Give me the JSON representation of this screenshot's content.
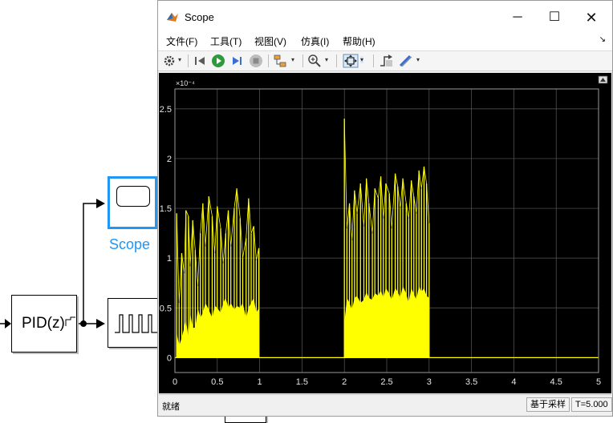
{
  "window": {
    "title": "Scope",
    "controls": {
      "minimize": "─",
      "maximize": "☐",
      "close": "✕"
    }
  },
  "menu": {
    "file": "文件(F)",
    "tools": "工具(T)",
    "view": "视图(V)",
    "simulation": "仿真(I)",
    "help": "帮助(H)"
  },
  "toolbar_icons": [
    "gear-icon",
    "step-back-icon",
    "run-icon",
    "step-forward-icon",
    "stop-icon",
    "signal-select-icon",
    "zoom-in-icon",
    "autoscale-icon",
    "triggers-icon",
    "measurements-icon"
  ],
  "status": {
    "left": "就绪",
    "mode": "基于采样",
    "time": "T=5.000"
  },
  "model": {
    "scope_label": "Scope",
    "pid_label": "PID(z)"
  },
  "colors": {
    "trace": "#ffff00",
    "plot_bg": "#000000",
    "grid": "#5a5a5a",
    "axis_text": "#e6e6e6",
    "selection": "#2196f3"
  },
  "chart_data": {
    "type": "line",
    "title": "",
    "xlabel": "",
    "ylabel": "",
    "y_exponent_label": "×10⁻⁴",
    "xlim": [
      0,
      5
    ],
    "ylim": [
      -0.15,
      2.7
    ],
    "x_ticks": [
      "0",
      "0.5",
      "1",
      "1.5",
      "2",
      "2.5",
      "3",
      "3.5",
      "4",
      "4.5",
      "5"
    ],
    "y_ticks": [
      "0",
      "0.5",
      "1",
      "1.5",
      "2",
      "2.5"
    ],
    "grid": true,
    "series": [
      {
        "color": "#ffff00",
        "segments": [
          {
            "x": [
              0.02,
              0.05,
              0.08,
              0.11,
              0.13,
              0.16,
              0.18,
              0.21,
              0.24,
              0.27,
              0.3,
              0.33,
              0.36,
              0.4,
              0.44,
              0.47,
              0.5,
              0.54,
              0.57,
              0.6,
              0.63,
              0.66,
              0.7,
              0.73,
              0.77,
              0.8,
              0.84,
              0.87,
              0.9,
              0.93,
              0.96,
              0.99
            ],
            "y": [
              1.45,
              0.55,
              1.05,
              0.85,
              1.48,
              1.42,
              0.92,
              1.38,
              1.08,
              0.72,
              1.25,
              1.55,
              1.12,
              1.62,
              1.42,
              1.05,
              1.52,
              1.3,
              0.95,
              1.25,
              1.48,
              1.12,
              1.5,
              1.7,
              1.4,
              1.0,
              1.2,
              1.6,
              1.25,
              1.32,
              0.98,
              1.1
            ],
            "base_y": [
              0.25,
              0.12,
              0.2,
              0.3,
              0.38,
              0.2,
              0.45,
              0.3,
              0.3,
              0.5,
              0.4,
              0.45,
              0.55,
              0.48,
              0.4,
              0.52,
              0.5,
              0.45,
              0.55,
              0.6,
              0.5,
              0.55,
              0.48,
              0.52,
              0.5,
              0.55,
              0.4,
              0.5,
              0.55,
              0.6,
              0.45,
              0.5
            ]
          },
          {
            "x": [
              2.0,
              2.03,
              2.06,
              2.09,
              2.12,
              2.15,
              2.19,
              2.23,
              2.26,
              2.29,
              2.33,
              2.36,
              2.4,
              2.43,
              2.46,
              2.49,
              2.53,
              2.56,
              2.6,
              2.63,
              2.66,
              2.69,
              2.73,
              2.76,
              2.79,
              2.82,
              2.85,
              2.88,
              2.91,
              2.94,
              2.97,
              3.0
            ],
            "y": [
              2.4,
              1.3,
              1.55,
              1.18,
              1.68,
              1.45,
              1.75,
              1.32,
              1.8,
              1.55,
              1.25,
              1.7,
              1.6,
              1.82,
              1.4,
              1.75,
              1.65,
              1.3,
              1.85,
              1.72,
              1.5,
              1.8,
              1.55,
              1.4,
              1.78,
              1.62,
              1.45,
              1.88,
              1.7,
              1.92,
              1.75,
              1.35
            ],
            "base_y": [
              0.35,
              0.6,
              0.55,
              0.48,
              0.6,
              0.62,
              0.55,
              0.58,
              0.66,
              0.6,
              0.58,
              0.65,
              0.62,
              0.68,
              0.6,
              0.7,
              0.64,
              0.58,
              0.7,
              0.66,
              0.6,
              0.72,
              0.64,
              0.55,
              0.7,
              0.64,
              0.58,
              0.72,
              0.66,
              0.7,
              0.62,
              0.6
            ]
          }
        ],
        "zero_line": [
          [
            0,
            0
          ],
          [
            5,
            0
          ]
        ]
      }
    ]
  }
}
